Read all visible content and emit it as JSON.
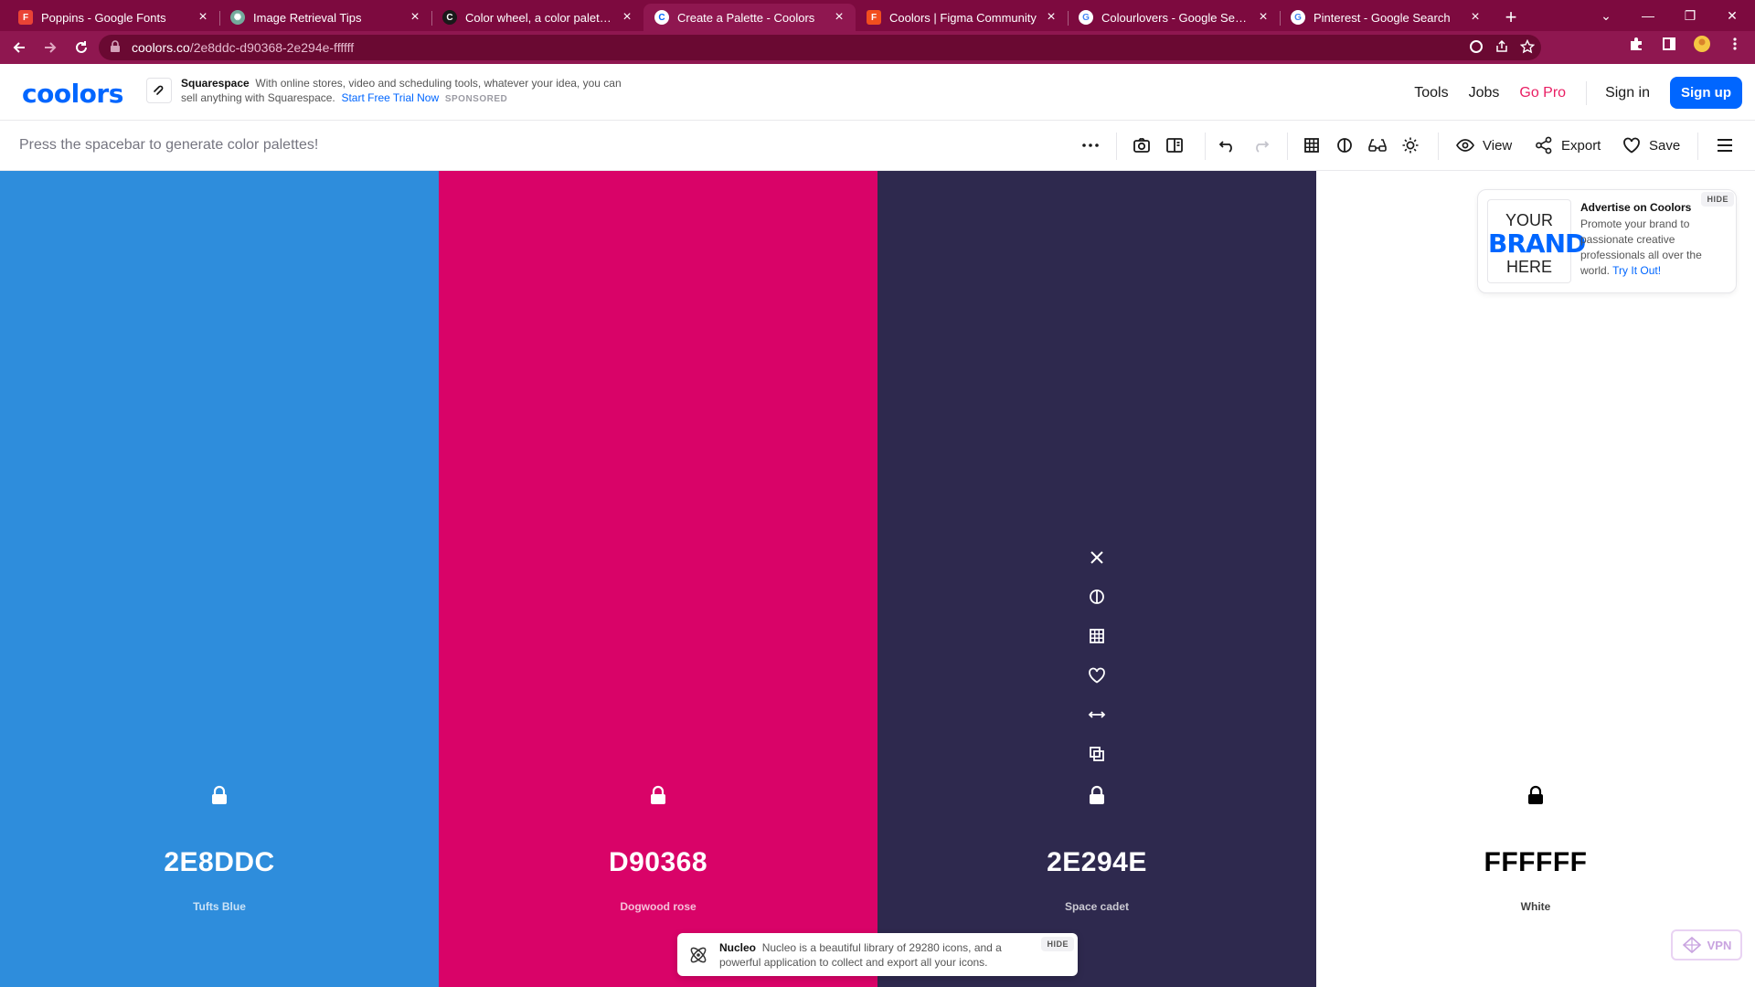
{
  "browser": {
    "tabs": [
      {
        "title": "Poppins - Google Fonts",
        "favicon": "google-fonts-icon",
        "color": "#ea4335",
        "active": false
      },
      {
        "title": "Image Retrieval Tips",
        "favicon": "chatgpt-icon",
        "color": "#74aa9c",
        "active": false
      },
      {
        "title": "Color wheel, a color palette generator | Adobe Color",
        "favicon": "adobe-color-icon",
        "color": "#000000",
        "active": false
      },
      {
        "title": "Create a Palette - Coolors",
        "favicon": "coolors-icon",
        "color": "#0066ff",
        "active": true
      },
      {
        "title": "Coolors | Figma Community",
        "favicon": "figma-icon",
        "color": "#f24e1e",
        "active": false
      },
      {
        "title": "Colourlovers - Google Search",
        "favicon": "google-icon",
        "color": "#4285f4",
        "active": false
      },
      {
        "title": "Pinterest - Google Search",
        "favicon": "google-icon",
        "color": "#4285f4",
        "active": false
      }
    ],
    "url_host": "coolors.co",
    "url_path": "/2e8ddc-d90368-2e294e-ffffff",
    "chrome_color": "#8f1750"
  },
  "header": {
    "logo": "coolors",
    "sponsor": {
      "name": "Squarespace",
      "text": "With online stores, video and scheduling tools, whatever your idea, you can sell anything with Squarespace.",
      "link": "Start Free Trial Now",
      "tag": "SPONSORED"
    },
    "nav": {
      "tools": "Tools",
      "jobs": "Jobs",
      "gopro": "Go Pro",
      "signin": "Sign in",
      "signup": "Sign up"
    }
  },
  "toolbar": {
    "hint": "Press the spacebar to generate color palettes!",
    "view": "View",
    "export": "Export",
    "save": "Save"
  },
  "palette": {
    "colors": [
      {
        "hex": "2E8DDC",
        "name": "Tufts Blue",
        "bg": "#2e8ddc",
        "fg": "#ffffff"
      },
      {
        "hex": "D90368",
        "name": "Dogwood rose",
        "bg": "#d90368",
        "fg": "#ffffff"
      },
      {
        "hex": "2E294E",
        "name": "Space cadet",
        "bg": "#2e294e",
        "fg": "#ffffff"
      },
      {
        "hex": "FFFFFF",
        "name": "White",
        "bg": "#ffffff",
        "fg": "#000000"
      }
    ],
    "hovered_index": 2
  },
  "ads": {
    "advertise": {
      "box_line1": "YOUR",
      "box_line2": "BRAND",
      "box_line3": "HERE",
      "title": "Advertise on Coolors",
      "text": "Promote your brand to passionate creative professionals all over the world.",
      "link": "Try It Out!",
      "hide": "HIDE"
    },
    "nucleo": {
      "name": "Nucleo",
      "text": "Nucleo is a beautiful library of 29280 icons, and a powerful application to collect and export all your icons.",
      "hide": "HIDE"
    },
    "vpn": "VPN"
  }
}
